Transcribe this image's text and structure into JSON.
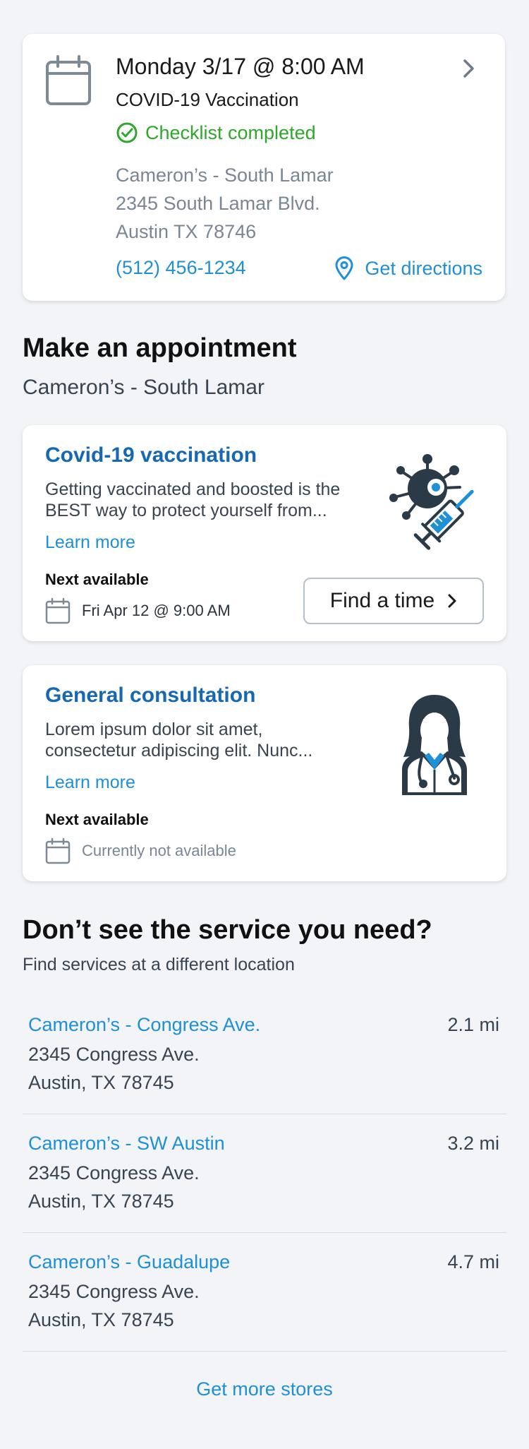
{
  "appointment": {
    "date_time": "Monday 3/17 @ 8:00 AM",
    "service": "COVID-19 Vaccination",
    "checklist_status": "Checklist completed",
    "address_lines": [
      "Cameron’s - South Lamar",
      "2345 South Lamar Blvd.",
      "Austin TX 78746"
    ],
    "phone": "(512) 456-1234",
    "directions_label": "Get directions",
    "icons": [
      "calendar-icon",
      "chevron-right-icon",
      "check-circle-icon",
      "location-pin-icon"
    ]
  },
  "make_appointment": {
    "title": "Make an appointment",
    "location": "Cameron’s - South Lamar",
    "services": [
      {
        "title": "Covid-19 vaccination",
        "description_line1": "Getting vaccinated and boosted is the",
        "description_line2": "BEST way to protect yourself from...",
        "learn_more": "Learn more",
        "next_label": "Next available",
        "next_value": "Fri Apr 12 @ 9:00 AM",
        "button_label": "Find a time",
        "icon": "virus-syringe-icon"
      },
      {
        "title": "General consultation",
        "description_line1": "Lorem ipsum dolor sit amet,",
        "description_line2": "consectetur adipiscing elit. Nunc...",
        "learn_more": "Learn more",
        "next_label": "Next available",
        "next_value": "Currently not available",
        "icon": "doctor-icon"
      }
    ]
  },
  "other_locations": {
    "title": "Don’t see the service you need?",
    "subtitle": "Find services at a different location",
    "locations": [
      {
        "name": "Cameron’s - Congress Ave.",
        "street": "2345 Congress Ave.",
        "city": "Austin, TX 78745",
        "distance": "2.1 mi"
      },
      {
        "name": "Cameron’s - SW Austin",
        "street": "2345 Congress Ave.",
        "city": "Austin, TX 78745",
        "distance": "3.2 mi"
      },
      {
        "name": "Cameron’s - Guadalupe",
        "street": "2345 Congress Ave.",
        "city": "Austin, TX 78745",
        "distance": "4.7 mi"
      }
    ],
    "more_label": "Get more stores"
  },
  "colors": {
    "link": "#1f8fd6",
    "title_blue": "#1668b2",
    "success": "#2fa82a",
    "muted": "#7a8694",
    "icon_slate": "#3d4a57",
    "background": "#f2f4f7"
  }
}
